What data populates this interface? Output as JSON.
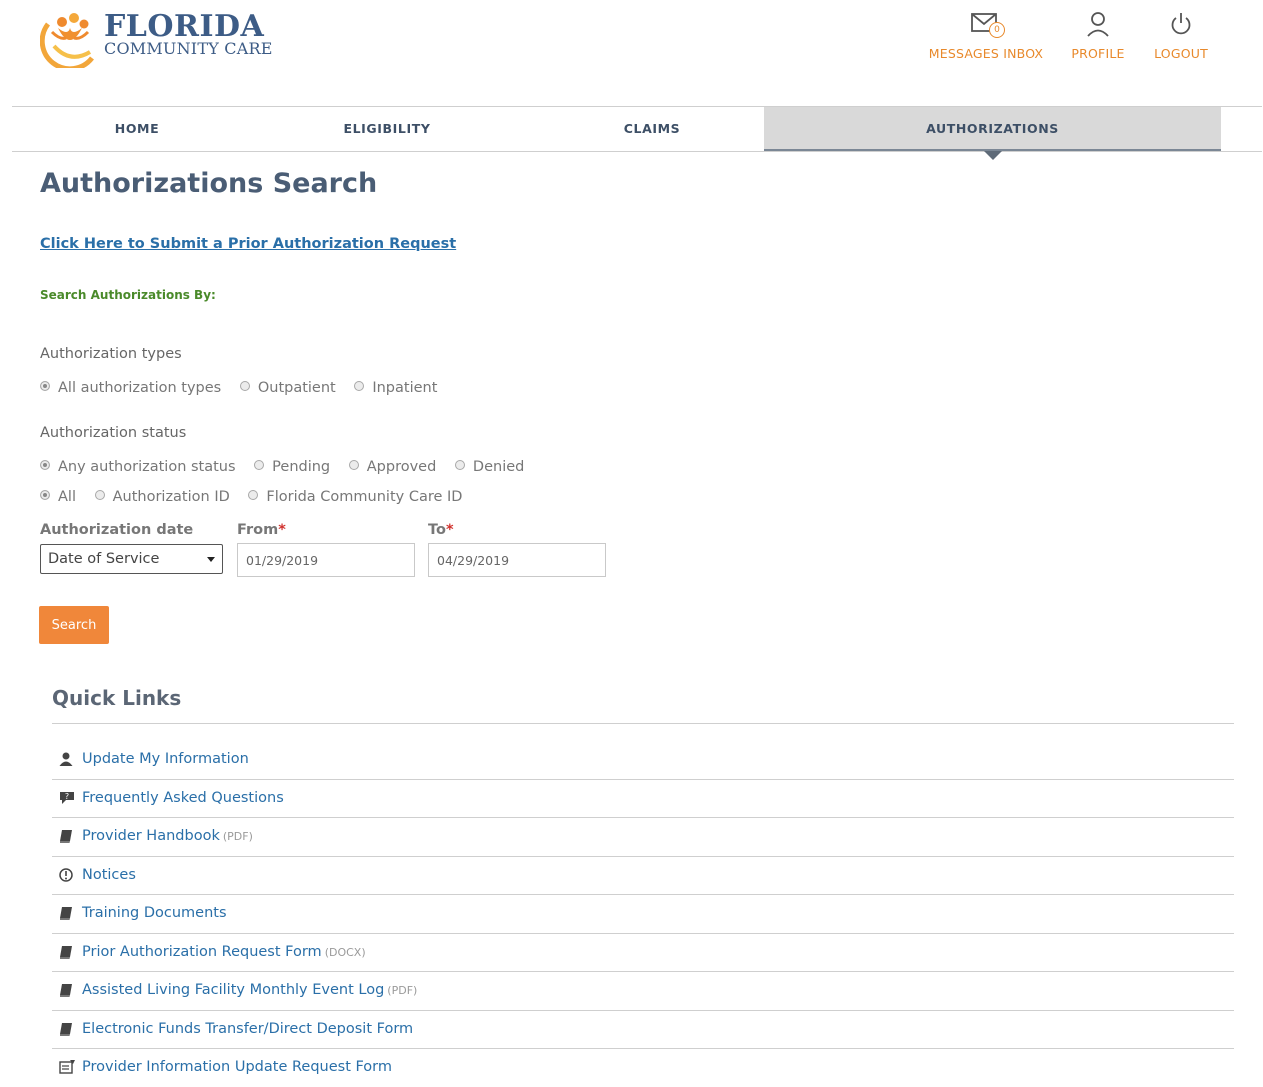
{
  "header": {
    "logo_title": "FLORIDA",
    "logo_subtitle": "COMMUNITY CARE",
    "messages": {
      "label": "MESSAGES INBOX",
      "count": "0"
    },
    "profile_label": "PROFILE",
    "logout_label": "LOGOUT",
    "accent_color": "#e8892b"
  },
  "nav": {
    "items": [
      "HOME",
      "ELIGIBILITY",
      "CLAIMS",
      "AUTHORIZATIONS"
    ],
    "active": "AUTHORIZATIONS"
  },
  "main": {
    "title": "Authorizations Search",
    "prior_auth_link": "Click Here to Submit a Prior Authorization Request",
    "search_by": "Search Authorizations By:",
    "types": {
      "label": "Authorization types",
      "options": [
        "All authorization types",
        "Outpatient",
        "Inpatient"
      ],
      "selected": "All authorization types"
    },
    "status": {
      "label": "Authorization status",
      "options": [
        "Any authorization status",
        "Pending",
        "Approved",
        "Denied"
      ],
      "selected": "Any authorization status"
    },
    "id_filter": {
      "options": [
        "All",
        "Authorization ID",
        "Florida Community Care ID"
      ],
      "selected": "All"
    },
    "date": {
      "label": "Authorization date",
      "select_value": "Date of Service",
      "from_label": "From",
      "to_label": "To",
      "required_mark": "*",
      "from_value": "01/29/2019",
      "to_value": "04/29/2019"
    },
    "search_button": "Search"
  },
  "quick_links": {
    "title": "Quick Links",
    "items": [
      {
        "icon": "user-icon",
        "label": "Update My Information",
        "tag": ""
      },
      {
        "icon": "chat-question-icon",
        "label": "Frequently Asked Questions",
        "tag": ""
      },
      {
        "icon": "book-icon",
        "label": "Provider Handbook",
        "tag": "(PDF)"
      },
      {
        "icon": "info-icon",
        "label": "Notices",
        "tag": ""
      },
      {
        "icon": "book-icon",
        "label": "Training Documents",
        "tag": ""
      },
      {
        "icon": "book-icon",
        "label": "Prior Authorization Request Form",
        "tag": "(DOCX)"
      },
      {
        "icon": "book-icon",
        "label": "Assisted Living Facility Monthly Event Log",
        "tag": "(PDF)"
      },
      {
        "icon": "book-icon",
        "label": "Electronic Funds Transfer/Direct Deposit Form",
        "tag": ""
      },
      {
        "icon": "form-icon",
        "label": "Provider Information Update Request Form",
        "tag": ""
      }
    ]
  }
}
